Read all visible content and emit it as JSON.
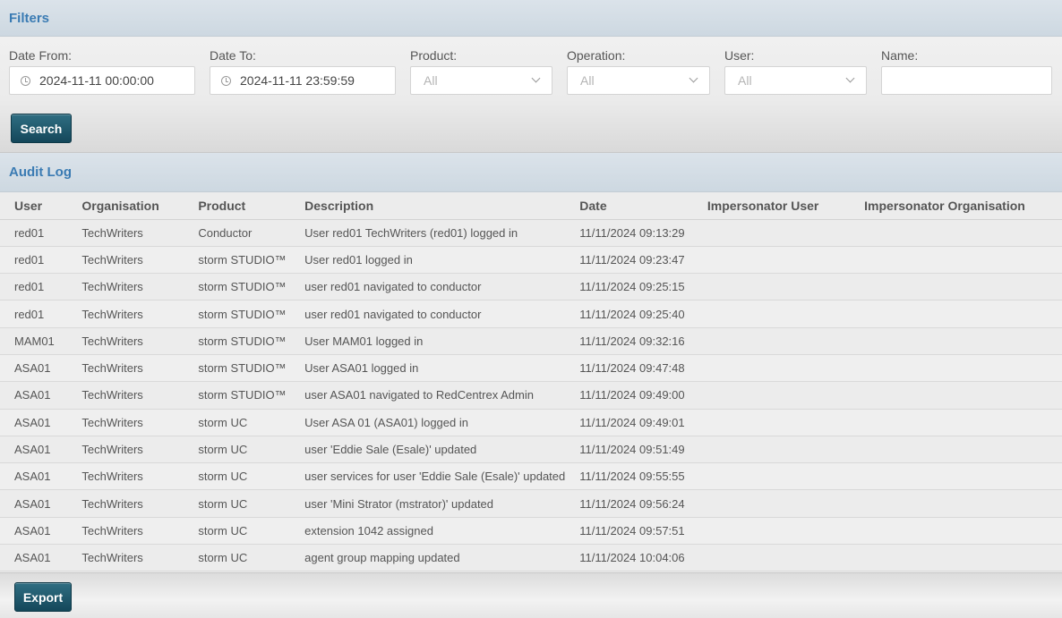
{
  "filters": {
    "title": "Filters",
    "date_from": {
      "label": "Date From:",
      "value": "2024-11-11 00:00:00"
    },
    "date_to": {
      "label": "Date To:",
      "value": "2024-11-11 23:59:59"
    },
    "product": {
      "label": "Product:",
      "value": "All"
    },
    "operation": {
      "label": "Operation:",
      "value": "All"
    },
    "user": {
      "label": "User:",
      "value": "All"
    },
    "name": {
      "label": "Name:",
      "value": ""
    },
    "search_label": "Search"
  },
  "audit": {
    "title": "Audit Log",
    "columns": [
      "User",
      "Organisation",
      "Product",
      "Description",
      "Date",
      "Impersonator User",
      "Impersonator Organisation"
    ],
    "rows": [
      [
        "red01",
        "TechWriters",
        "Conductor",
        "User red01 TechWriters (red01) logged in",
        "11/11/2024 09:13:29",
        "",
        ""
      ],
      [
        "red01",
        "TechWriters",
        "storm STUDIO™",
        "User red01 logged in",
        "11/11/2024 09:23:47",
        "",
        ""
      ],
      [
        "red01",
        "TechWriters",
        "storm STUDIO™",
        "user red01 navigated to conductor",
        "11/11/2024 09:25:15",
        "",
        ""
      ],
      [
        "red01",
        "TechWriters",
        "storm STUDIO™",
        "user red01 navigated to conductor",
        "11/11/2024 09:25:40",
        "",
        ""
      ],
      [
        "MAM01",
        "TechWriters",
        "storm STUDIO™",
        "User MAM01 logged in",
        "11/11/2024 09:32:16",
        "",
        ""
      ],
      [
        "ASA01",
        "TechWriters",
        "storm STUDIO™",
        "User ASA01 logged in",
        "11/11/2024 09:47:48",
        "",
        ""
      ],
      [
        "ASA01",
        "TechWriters",
        "storm STUDIO™",
        "user ASA01 navigated to RedCentrex Admin",
        "11/11/2024 09:49:00",
        "",
        ""
      ],
      [
        "ASA01",
        "TechWriters",
        "storm UC",
        "User ASA 01 (ASA01) logged in",
        "11/11/2024 09:49:01",
        "",
        ""
      ],
      [
        "ASA01",
        "TechWriters",
        "storm UC",
        "user 'Eddie Sale (Esale)' updated",
        "11/11/2024 09:51:49",
        "",
        ""
      ],
      [
        "ASA01",
        "TechWriters",
        "storm UC",
        "user services for user 'Eddie Sale (Esale)' updated",
        "11/11/2024 09:55:55",
        "",
        ""
      ],
      [
        "ASA01",
        "TechWriters",
        "storm UC",
        "user 'Mini Strator (mstrator)' updated",
        "11/11/2024 09:56:24",
        "",
        ""
      ],
      [
        "ASA01",
        "TechWriters",
        "storm UC",
        "extension 1042 assigned",
        "11/11/2024 09:57:51",
        "",
        ""
      ],
      [
        "ASA01",
        "TechWriters",
        "storm UC",
        "agent group mapping updated",
        "11/11/2024 10:04:06",
        "",
        ""
      ]
    ],
    "export_label": "Export"
  }
}
